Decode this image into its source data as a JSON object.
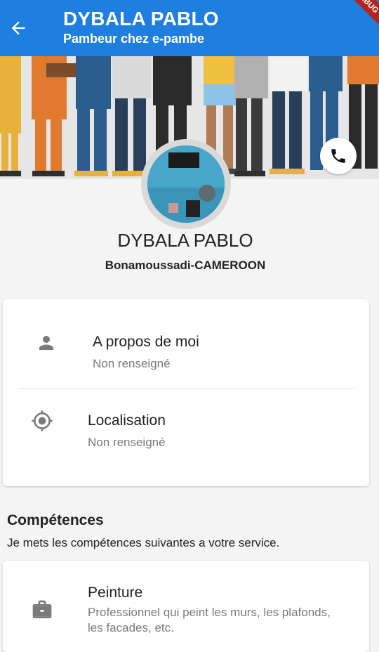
{
  "appbar": {
    "title": "DYBALA PABLO",
    "subtitle": "Pambeur chez e-pambe",
    "debug_banner": "DEBUG",
    "back_icon": "arrow-left-icon",
    "color": "#1f7fe0"
  },
  "profile": {
    "name": "DYBALA PABLO",
    "location": "Bonamoussadi-CAMEROON",
    "call_icon": "phone-icon"
  },
  "about": {
    "items": [
      {
        "icon": "person-icon",
        "label": "A propos de moi",
        "value": "Non renseigné"
      },
      {
        "icon": "location-target-icon",
        "label": "Localisation",
        "value": "Non renseigné"
      }
    ]
  },
  "skills": {
    "title": "Compétences",
    "description": "Je mets les compétences suivantes a votre service.",
    "items": [
      {
        "icon": "briefcase-icon",
        "label": "Peinture",
        "description": "Professionnel qui peint les murs, les plafonds, les facades, etc."
      }
    ]
  }
}
